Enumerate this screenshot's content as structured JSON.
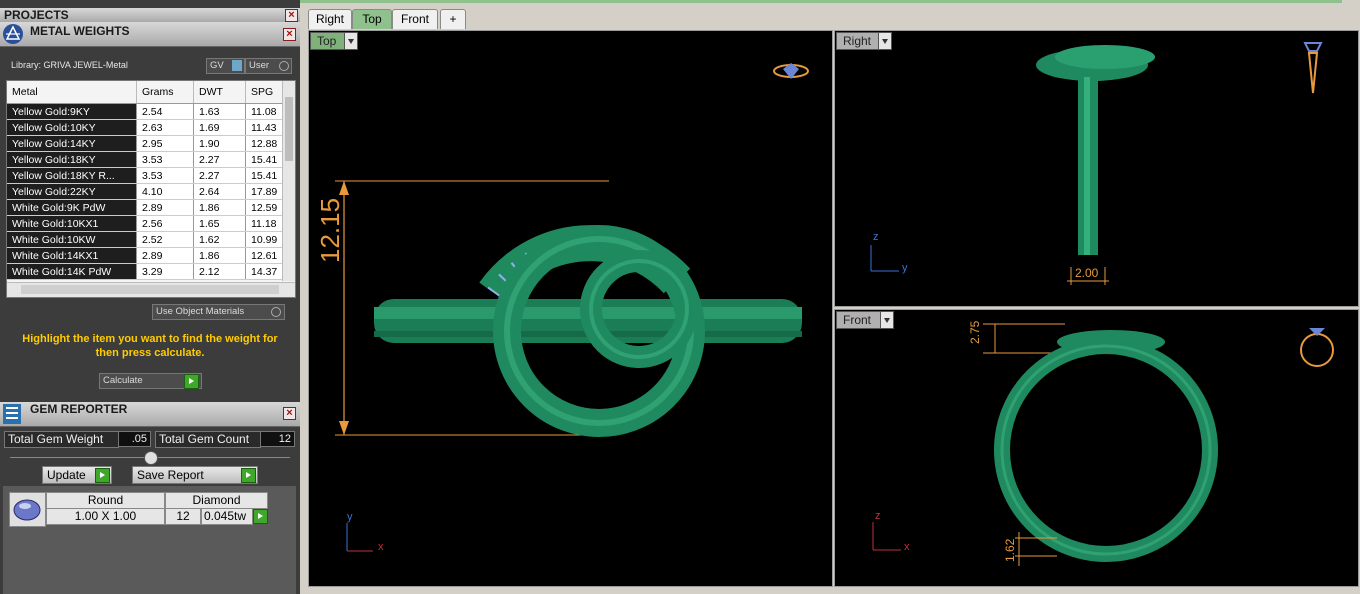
{
  "projects_panel": {
    "title": "PROJECTS"
  },
  "metal_weights": {
    "title": "METAL WEIGHTS",
    "library_label": "Library: GRIVA JEWEL-Metal",
    "gv_label": "GV",
    "user_label": "User",
    "columns": [
      "Metal",
      "Grams",
      "DWT",
      "SPG"
    ],
    "rows": [
      [
        "Yellow Gold:9KY",
        "2.54",
        "1.63",
        "11.08"
      ],
      [
        "Yellow Gold:10KY",
        "2.63",
        "1.69",
        "11.43"
      ],
      [
        "Yellow Gold:14KY",
        "2.95",
        "1.90",
        "12.88"
      ],
      [
        "Yellow Gold:18KY",
        "3.53",
        "2.27",
        "15.41"
      ],
      [
        "Yellow Gold:18KY R...",
        "3.53",
        "2.27",
        "15.41"
      ],
      [
        "Yellow Gold:22KY",
        "4.10",
        "2.64",
        "17.89"
      ],
      [
        "White Gold:9K PdW",
        "2.89",
        "1.86",
        "12.59"
      ],
      [
        "White Gold:10KX1",
        "2.56",
        "1.65",
        "11.18"
      ],
      [
        "White Gold:10KW",
        "2.52",
        "1.62",
        "10.99"
      ],
      [
        "White Gold:14KX1",
        "2.89",
        "1.86",
        "12.61"
      ],
      [
        "White Gold:14K PdW",
        "3.29",
        "2.12",
        "14.37"
      ]
    ],
    "use_object_materials": "Use Object Materials",
    "hint": "Highlight the item you want to find the weight for then press calculate.",
    "calculate_label": "Calculate"
  },
  "gem_reporter": {
    "title": "GEM REPORTER",
    "total_weight_label": "Total Gem Weight",
    "total_weight_value": ".05",
    "total_count_label": "Total Gem Count",
    "total_count_value": "12",
    "update_label": "Update",
    "save_report_label": "Save Report",
    "gem": {
      "shape": "Round",
      "type": "Diamond",
      "size": "1.00 X 1.00",
      "count": "12",
      "weight": "0.045tw"
    }
  },
  "tabs": [
    "Right",
    "Top",
    "Front"
  ],
  "active_tab": "Top",
  "viewports": {
    "top": {
      "label": "Top",
      "dimension": "12.15",
      "axis_x": "x",
      "axis_y": "y"
    },
    "right": {
      "label": "Right",
      "dimension": "2.00",
      "axis_a": "z",
      "axis_b": "y"
    },
    "front": {
      "label": "Front",
      "dimension_top": "2.75",
      "dimension_bottom": "1.62",
      "axis_a": "z",
      "axis_b": "x"
    }
  },
  "colors": {
    "metal": "#1f8a5f",
    "gem": "#8fb0ea",
    "dimension": "#e89a3c",
    "active_tab": "#8fc18c"
  }
}
